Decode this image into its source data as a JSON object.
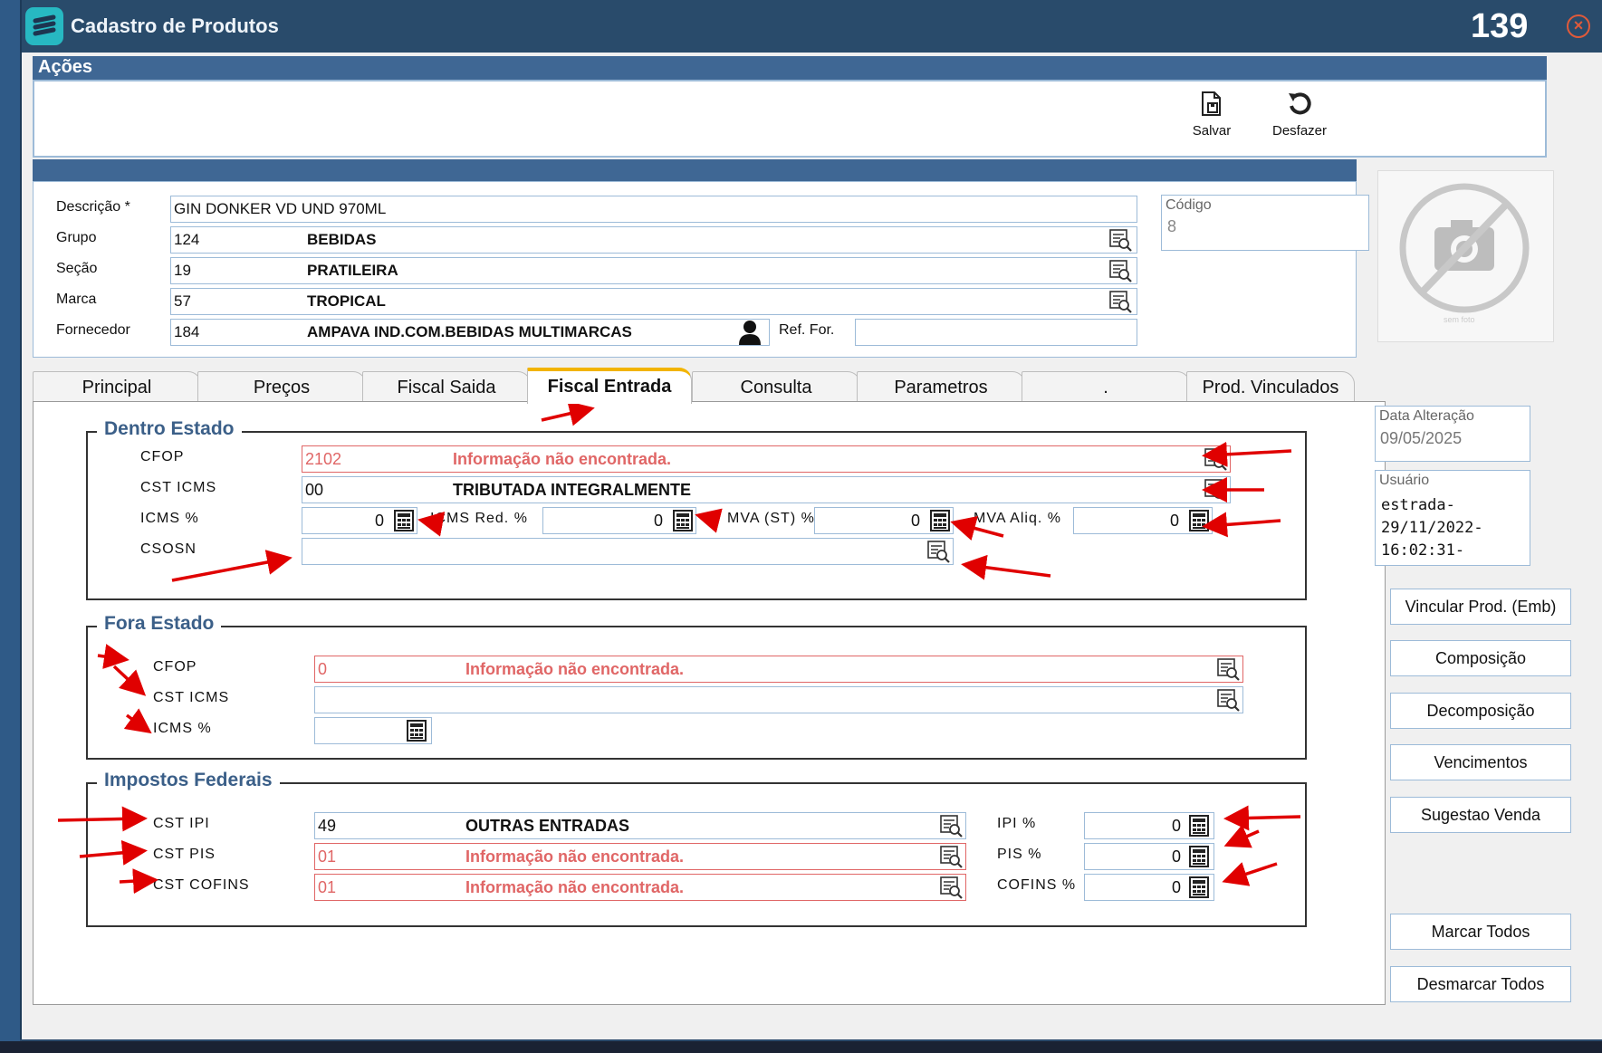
{
  "window": {
    "title": "Cadastro de Produtos",
    "number": "139",
    "close_glyph": "×"
  },
  "acoes": {
    "header": "Ações",
    "buttons": [
      {
        "label": "Salvar",
        "icon": "save-document-icon"
      },
      {
        "label": "Desfazer",
        "icon": "undo-icon"
      }
    ]
  },
  "produto": {
    "descricao_label": "Descrição *",
    "descricao_value": "GIN DONKER VD UND 970ML",
    "grupo_label": "Grupo",
    "grupo_code": "124",
    "grupo_desc": "BEBIDAS",
    "secao_label": "Seção",
    "secao_code": "19",
    "secao_desc": "PRATILEIRA",
    "marca_label": "Marca",
    "marca_code": "57",
    "marca_desc": "TROPICAL",
    "fornecedor_label": "Fornecedor",
    "fornecedor_code": "184",
    "fornecedor_desc": "AMPAVA IND.COM.BEBIDAS MULTIMARCAS",
    "ref_for_label": "Ref. For.",
    "ref_for_value": "",
    "codigo_label": "Código",
    "codigo_value": "8",
    "photo_caption": "sem foto"
  },
  "tabs": [
    {
      "label": "Principal",
      "active": false
    },
    {
      "label": "Preços",
      "active": false
    },
    {
      "label": "Fiscal Saida",
      "active": false
    },
    {
      "label": "Fiscal Entrada",
      "active": true
    },
    {
      "label": "Consulta",
      "active": false
    },
    {
      "label": "Parametros",
      "active": false
    },
    {
      "label": ".",
      "active": false
    },
    {
      "label": "Prod. Vinculados",
      "active": false
    }
  ],
  "dentro_estado": {
    "title": "Dentro Estado",
    "cfop_label": "CFOP",
    "cfop_code": "2102",
    "cfop_desc": "Informação não encontrada.",
    "cst_icms_label": "CST ICMS",
    "cst_icms_code": "00",
    "cst_icms_desc": "TRIBUTADA INTEGRALMENTE",
    "icms_pct_label": "ICMS %",
    "icms_pct_value": "0",
    "icms_red_label": "ICMS Red. %",
    "icms_red_value": "0",
    "mva_st_label": "MVA (ST) %",
    "mva_st_value": "0",
    "mva_aliq_label": "MVA Aliq. %",
    "mva_aliq_value": "0",
    "csosn_label": "CSOSN",
    "csosn_value": ""
  },
  "fora_estado": {
    "title": "Fora Estado",
    "cfop_label": "CFOP",
    "cfop_code": "0",
    "cfop_desc": "Informação não encontrada.",
    "cst_icms_label": "CST ICMS",
    "cst_icms_value": "",
    "icms_pct_label": "ICMS %",
    "icms_pct_value": ""
  },
  "impostos_federais": {
    "title": "Impostos Federais",
    "cst_ipi_label": "CST IPI",
    "cst_ipi_code": "49",
    "cst_ipi_desc": "OUTRAS ENTRADAS",
    "cst_pis_label": "CST PIS",
    "cst_pis_code": "01",
    "cst_pis_desc": "Informação não encontrada.",
    "cst_cofins_label": "CST COFINS",
    "cst_cofins_code": "01",
    "cst_cofins_desc": "Informação não encontrada.",
    "ipi_pct_label": "IPI %",
    "ipi_pct_value": "0",
    "pis_pct_label": "PIS %",
    "pis_pct_value": "0",
    "cofins_pct_label": "COFINS %",
    "cofins_pct_value": "0"
  },
  "side": {
    "data_alteracao_label": "Data Alteração",
    "data_alteracao_value": "09/05/2025",
    "usuario_label": "Usuário",
    "usuario_value": "estrada-\n29/11/2022-\n16:02:31-",
    "buttons": [
      "Vincular Prod. (Emb)",
      "Composição",
      "Decomposição",
      "Vencimentos",
      "Sugestao Venda",
      "Marcar Todos",
      "Desmarcar Todos"
    ]
  },
  "colors": {
    "titlebar": "#294b6b",
    "accent_blue": "#3f6794",
    "error_red": "#e06666",
    "annotation_arrow": "#e00000",
    "active_tab_marker": "#f2b400"
  }
}
